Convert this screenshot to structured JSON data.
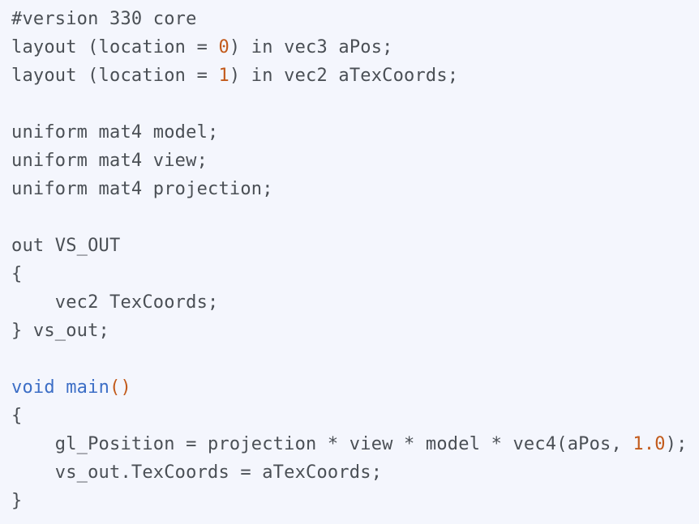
{
  "code_block": {
    "language": "glsl",
    "lines": [
      [
        {
          "t": "#version 330 core",
          "c": "plain"
        }
      ],
      [
        {
          "t": "layout (location = ",
          "c": "plain"
        },
        {
          "t": "0",
          "c": "num"
        },
        {
          "t": ") in vec3 aPos;",
          "c": "plain"
        }
      ],
      [
        {
          "t": "layout (location = ",
          "c": "plain"
        },
        {
          "t": "1",
          "c": "num"
        },
        {
          "t": ") in vec2 aTexCoords;",
          "c": "plain"
        }
      ],
      [],
      [
        {
          "t": "uniform mat4 model;",
          "c": "plain"
        }
      ],
      [
        {
          "t": "uniform mat4 view;",
          "c": "plain"
        }
      ],
      [
        {
          "t": "uniform mat4 projection;",
          "c": "plain"
        }
      ],
      [],
      [
        {
          "t": "out VS_OUT",
          "c": "plain"
        }
      ],
      [
        {
          "t": "{",
          "c": "plain"
        }
      ],
      [
        {
          "t": "    vec2 TexCoords;",
          "c": "plain"
        }
      ],
      [
        {
          "t": "} vs_out;",
          "c": "plain"
        }
      ],
      [],
      [
        {
          "t": "void",
          "c": "kw"
        },
        {
          "t": " ",
          "c": "plain"
        },
        {
          "t": "main",
          "c": "fn"
        },
        {
          "t": "()",
          "c": "punc"
        }
      ],
      [
        {
          "t": "{",
          "c": "plain"
        }
      ],
      [
        {
          "t": "    gl_Position = projection * view * model * vec4(aPos, ",
          "c": "plain"
        },
        {
          "t": "1.0",
          "c": "num"
        },
        {
          "t": ");",
          "c": "plain"
        }
      ],
      [
        {
          "t": "    vs_out.TexCoords = aTexCoords;",
          "c": "plain"
        }
      ],
      [
        {
          "t": "}",
          "c": "plain"
        }
      ]
    ]
  },
  "colors": {
    "background": "#f4f6fd",
    "text": "#4a4f55",
    "number": "#c25a1b",
    "keyword": "#3c6ec6",
    "function": "#3c6ec6"
  }
}
